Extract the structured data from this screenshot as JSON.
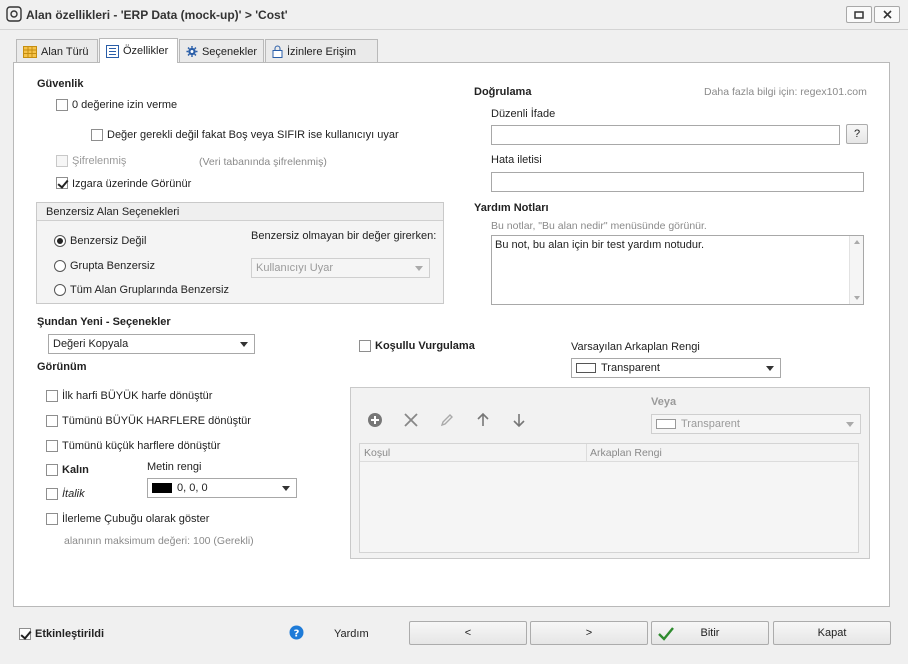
{
  "window": {
    "title": "Alan özellikleri - 'ERP Data (mock-up)' > 'Cost'"
  },
  "tabs": [
    {
      "label": "Alan Türü"
    },
    {
      "label": "Özellikler"
    },
    {
      "label": "Seçenekler"
    },
    {
      "label": "İzinlere Erişim"
    }
  ],
  "security": {
    "title": "Güvenlik",
    "no_zero": "0 değerine izin verme",
    "warn_empty": "Değer gerekli değil fakat Boş veya SIFIR ise kullanıcıyı uyar",
    "encrypted": "Şifrelenmiş",
    "encrypted_hint": "(Veri tabanında şifrelenmiş)",
    "visible_grid": "Izgara üzerinde Görünür"
  },
  "unique": {
    "title": "Benzersiz Alan Seçenekleri",
    "opt1": "Benzersiz Değil",
    "opt2": "Grupta Benzersiz",
    "opt3": "Tüm Alan Gruplarında Benzersiz",
    "non_unique_label": "Benzersiz olmayan bir değer girerken:",
    "non_unique_value": "Kullanıcıyı Uyar"
  },
  "validation": {
    "title": "Doğrulama",
    "more_info": "Daha fazla bilgi için: regex101.com",
    "regex_label": "Düzenli İfade",
    "regex_value": "",
    "help_btn": "?",
    "error_label": "Hata iletisi",
    "error_value": ""
  },
  "help_notes": {
    "title": "Yardım Notları",
    "hint": "Bu notlar, \"Bu alan nedir\" menüsünde görünür.",
    "text": "Bu not, bu alan için bir test yardım notudur."
  },
  "new_from": {
    "title": "Şundan Yeni - Seçenekler",
    "value": "Değeri Kopyala"
  },
  "appearance": {
    "title": "Görünüm",
    "first_upper": "İlk harfi BÜYÜK harfe dönüştür",
    "all_upper": "Tümünü BÜYÜK HARFLERE dönüştür",
    "all_lower": "Tümünü küçük harflere dönüştür",
    "bold": "Kalın",
    "italic": "İtalik",
    "text_color_label": "Metin rengi",
    "text_color_value": "0, 0, 0",
    "progress": "İlerleme Çubuğu olarak göster",
    "progress_hint": "alanının maksimum değeri: 100 (Gerekli)"
  },
  "conditional": {
    "title": "Koşullu Vurgulama",
    "default_bg_label": "Varsayılan Arkaplan Rengi",
    "default_bg_value": "Transparent",
    "or_label": "Veya",
    "or_value": "Transparent",
    "col_condition": "Koşul",
    "col_bg": "Arkaplan Rengi"
  },
  "footer": {
    "enabled": "Etkinleştirildi",
    "help": "Yardım",
    "prev": "<",
    "next": ">",
    "finish": "Bitir",
    "close": "Kapat"
  },
  "colors": {
    "accent_blue": "#1e7bd8",
    "finish_check": "#2e8b2e"
  }
}
